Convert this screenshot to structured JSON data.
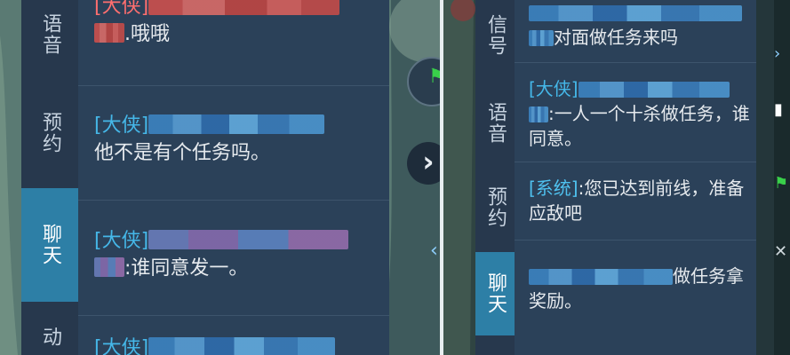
{
  "left": {
    "tabs": [
      {
        "label": "语音",
        "active": false
      },
      {
        "label": "预约",
        "active": false
      },
      {
        "label": "聊天",
        "active": true
      },
      {
        "label": "动",
        "active": false
      }
    ],
    "messages": [
      {
        "tag": "[大侠]",
        "text": ".哦哦",
        "color": "red"
      },
      {
        "tag": "[大侠]",
        "text": "他不是有个任务吗。",
        "color": "blue"
      },
      {
        "tag": "[大侠]",
        "text": ":谁同意发一。",
        "color": "blue"
      },
      {
        "tag": "[大侠]",
        "text": "",
        "color": "blue"
      }
    ],
    "side_icons": {
      "flag": "flag-icon",
      "close": "chevron-right-icon",
      "small_arrow": "chevron-left-icon"
    }
  },
  "right": {
    "tabs": [
      {
        "label": "信号",
        "active": false
      },
      {
        "label": "语音",
        "active": false
      },
      {
        "label": "预约",
        "active": false
      },
      {
        "label": "聊天",
        "active": true
      }
    ],
    "messages": [
      {
        "tag": "",
        "text": "对面做任务来吗"
      },
      {
        "tag": "[大侠]",
        "text": ":一人一个十杀做任务，谁同意。"
      },
      {
        "tag": "[系统]",
        "text": ":您已达到前线，准备应敌吧"
      },
      {
        "tag": "",
        "text": "做任务拿奖励。"
      }
    ]
  },
  "colors": {
    "tab_active": "#2d7fa6",
    "chat_bg": "#2b4159",
    "tag_blue": "#45b7e8",
    "tag_red": "#ff6f6f"
  }
}
